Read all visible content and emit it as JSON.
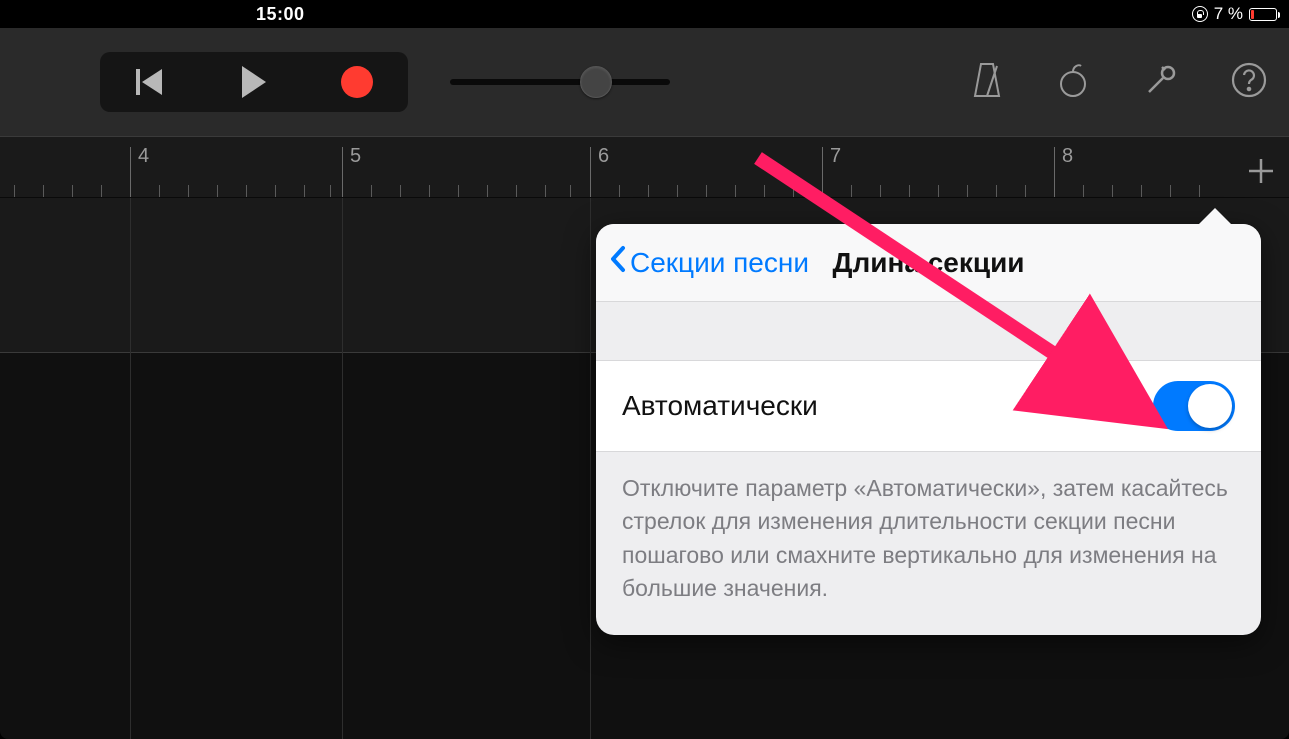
{
  "status": {
    "time": "15:00",
    "battery_percent": "7 %"
  },
  "toolbar": {},
  "ruler": {
    "numbers": [
      "4",
      "5",
      "6",
      "7",
      "8"
    ]
  },
  "popover": {
    "back_label": "Секции песни",
    "title": "Длина секции",
    "auto_label": "Автоматически",
    "auto_on": true,
    "description": "Отключите параметр «Автоматически», затем касайтесь стрелок для изменения длительности секции песни пошагово или смахните вертикально для изменения на большие значения."
  }
}
